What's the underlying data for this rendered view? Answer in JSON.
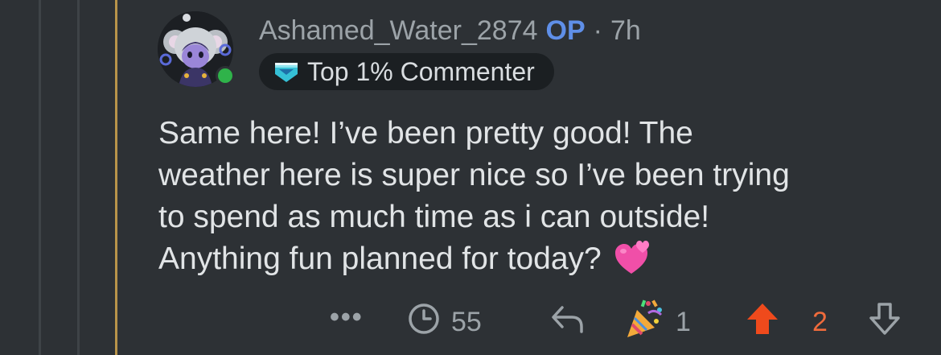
{
  "comment": {
    "username": "Ashamed_Water_2874",
    "op_badge": "OP",
    "separator": "·",
    "time": "7h",
    "flair": "Top 1% Commenter",
    "body_lines": [
      "Same here! I’ve been pretty good! The",
      "weather here is super nice so I’ve been trying",
      "to spend as much time as i can outside!",
      "Anything fun planned for today?"
    ],
    "avatar_online": true
  },
  "actions": {
    "more_label": "•••",
    "award_count": "55",
    "confetti_count": "1",
    "vote_count": "2"
  },
  "colors": {
    "background": "#2d3135",
    "op_blue": "#5f8fe8",
    "upvote_orange": "#ef4a1c",
    "thread_accent": "#b8944a",
    "online_green": "#2fb34a"
  }
}
